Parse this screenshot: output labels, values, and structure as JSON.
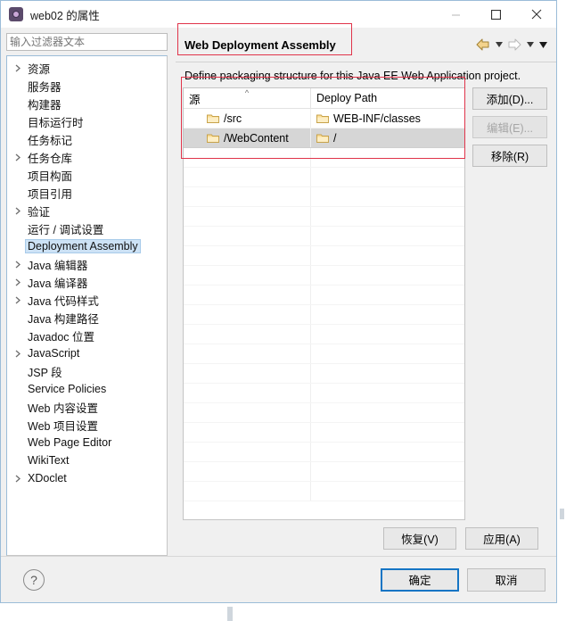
{
  "window": {
    "title": "web02 的属性",
    "app_icon": "properties-icon",
    "controls": {
      "minimize": "minimize-icon",
      "maximize": "maximize-icon",
      "close": "close-icon"
    }
  },
  "sidebar": {
    "filter": {
      "value": "",
      "placeholder": "输入过滤器文本"
    },
    "items": [
      {
        "label": "资源",
        "expandable": true,
        "selected": false
      },
      {
        "label": "服务器",
        "expandable": false,
        "selected": false
      },
      {
        "label": "构建器",
        "expandable": false,
        "selected": false
      },
      {
        "label": "目标运行时",
        "expandable": false,
        "selected": false
      },
      {
        "label": "任务标记",
        "expandable": false,
        "selected": false
      },
      {
        "label": "任务仓库",
        "expandable": true,
        "selected": false
      },
      {
        "label": "项目构面",
        "expandable": false,
        "selected": false
      },
      {
        "label": "项目引用",
        "expandable": false,
        "selected": false
      },
      {
        "label": "验证",
        "expandable": true,
        "selected": false
      },
      {
        "label": "运行 / 调试设置",
        "expandable": false,
        "selected": false
      },
      {
        "label": "Deployment Assembly",
        "expandable": false,
        "selected": true
      },
      {
        "label": "Java 编辑器",
        "expandable": true,
        "selected": false
      },
      {
        "label": "Java 编译器",
        "expandable": true,
        "selected": false
      },
      {
        "label": "Java 代码样式",
        "expandable": true,
        "selected": false
      },
      {
        "label": "Java 构建路径",
        "expandable": false,
        "selected": false
      },
      {
        "label": "Javadoc 位置",
        "expandable": false,
        "selected": false
      },
      {
        "label": "JavaScript",
        "expandable": true,
        "selected": false
      },
      {
        "label": "JSP 段",
        "expandable": false,
        "selected": false
      },
      {
        "label": "Service Policies",
        "expandable": false,
        "selected": false
      },
      {
        "label": "Web 内容设置",
        "expandable": false,
        "selected": false
      },
      {
        "label": "Web 项目设置",
        "expandable": false,
        "selected": false
      },
      {
        "label": "Web Page Editor",
        "expandable": false,
        "selected": false
      },
      {
        "label": "WikiText",
        "expandable": false,
        "selected": false
      },
      {
        "label": "XDoclet",
        "expandable": true,
        "selected": false
      }
    ]
  },
  "page": {
    "title": "Web Deployment Assembly",
    "description": "Define packaging structure for this Java EE Web Application project.",
    "nav": {
      "back_icon": "back-arrow-icon",
      "back_menu_icon": "chevron-down-icon",
      "forward_icon": "forward-arrow-icon",
      "forward_menu_icon": "chevron-down-icon",
      "overflow_menu_icon": "chevron-down-icon"
    },
    "table": {
      "columns": [
        "源",
        "Deploy Path"
      ],
      "sort_column": "源",
      "sort_indicator": "caret-up-icon",
      "rows": [
        {
          "source": "/src",
          "deploy_path": "WEB-INF/classes",
          "selected": false
        },
        {
          "source": "/WebContent",
          "deploy_path": "/",
          "selected": true
        }
      ],
      "empty_row_count": 18,
      "folder_icon": "folder-icon"
    },
    "side_buttons": [
      {
        "label": "添加(D)...",
        "name": "add-button",
        "disabled": false
      },
      {
        "label": "编辑(E)...",
        "name": "edit-button",
        "disabled": true
      },
      {
        "label": "移除(R)",
        "name": "remove-button",
        "disabled": false
      }
    ],
    "apply_buttons": [
      {
        "label": "恢复(V)",
        "name": "restore-defaults-button"
      },
      {
        "label": "应用(A)",
        "name": "apply-button"
      }
    ]
  },
  "footer": {
    "help_icon": "help-icon",
    "ok_label": "确定",
    "cancel_label": "取消"
  },
  "annotations": {
    "title_box": "red-highlight-title",
    "table_box": "red-highlight-table",
    "color": "#e0344a"
  }
}
